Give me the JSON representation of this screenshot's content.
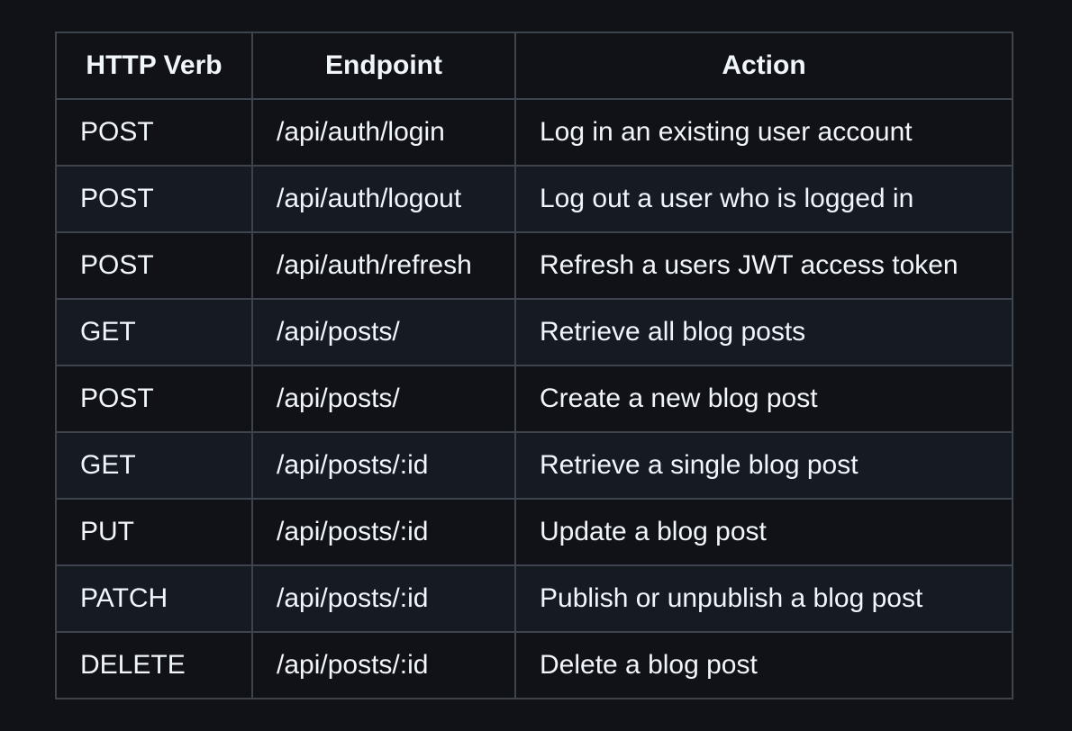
{
  "table": {
    "headers": [
      "HTTP Verb",
      "Endpoint",
      "Action"
    ],
    "rows": [
      [
        "POST",
        "/api/auth/login",
        "Log in an existing user account"
      ],
      [
        "POST",
        "/api/auth/logout",
        "Log out a user who is logged in"
      ],
      [
        "POST",
        "/api/auth/refresh",
        "Refresh a users JWT access token"
      ],
      [
        "GET",
        "/api/posts/",
        "Retrieve all blog posts"
      ],
      [
        "POST",
        "/api/posts/",
        "Create a new blog post"
      ],
      [
        "GET",
        "/api/posts/:id",
        "Retrieve a single blog post"
      ],
      [
        "PUT",
        "/api/posts/:id",
        "Update a blog post"
      ],
      [
        "PATCH",
        "/api/posts/:id",
        "Publish or unpublish a blog post"
      ],
      [
        "DELETE",
        "/api/posts/:id",
        "Delete a blog post"
      ]
    ]
  }
}
